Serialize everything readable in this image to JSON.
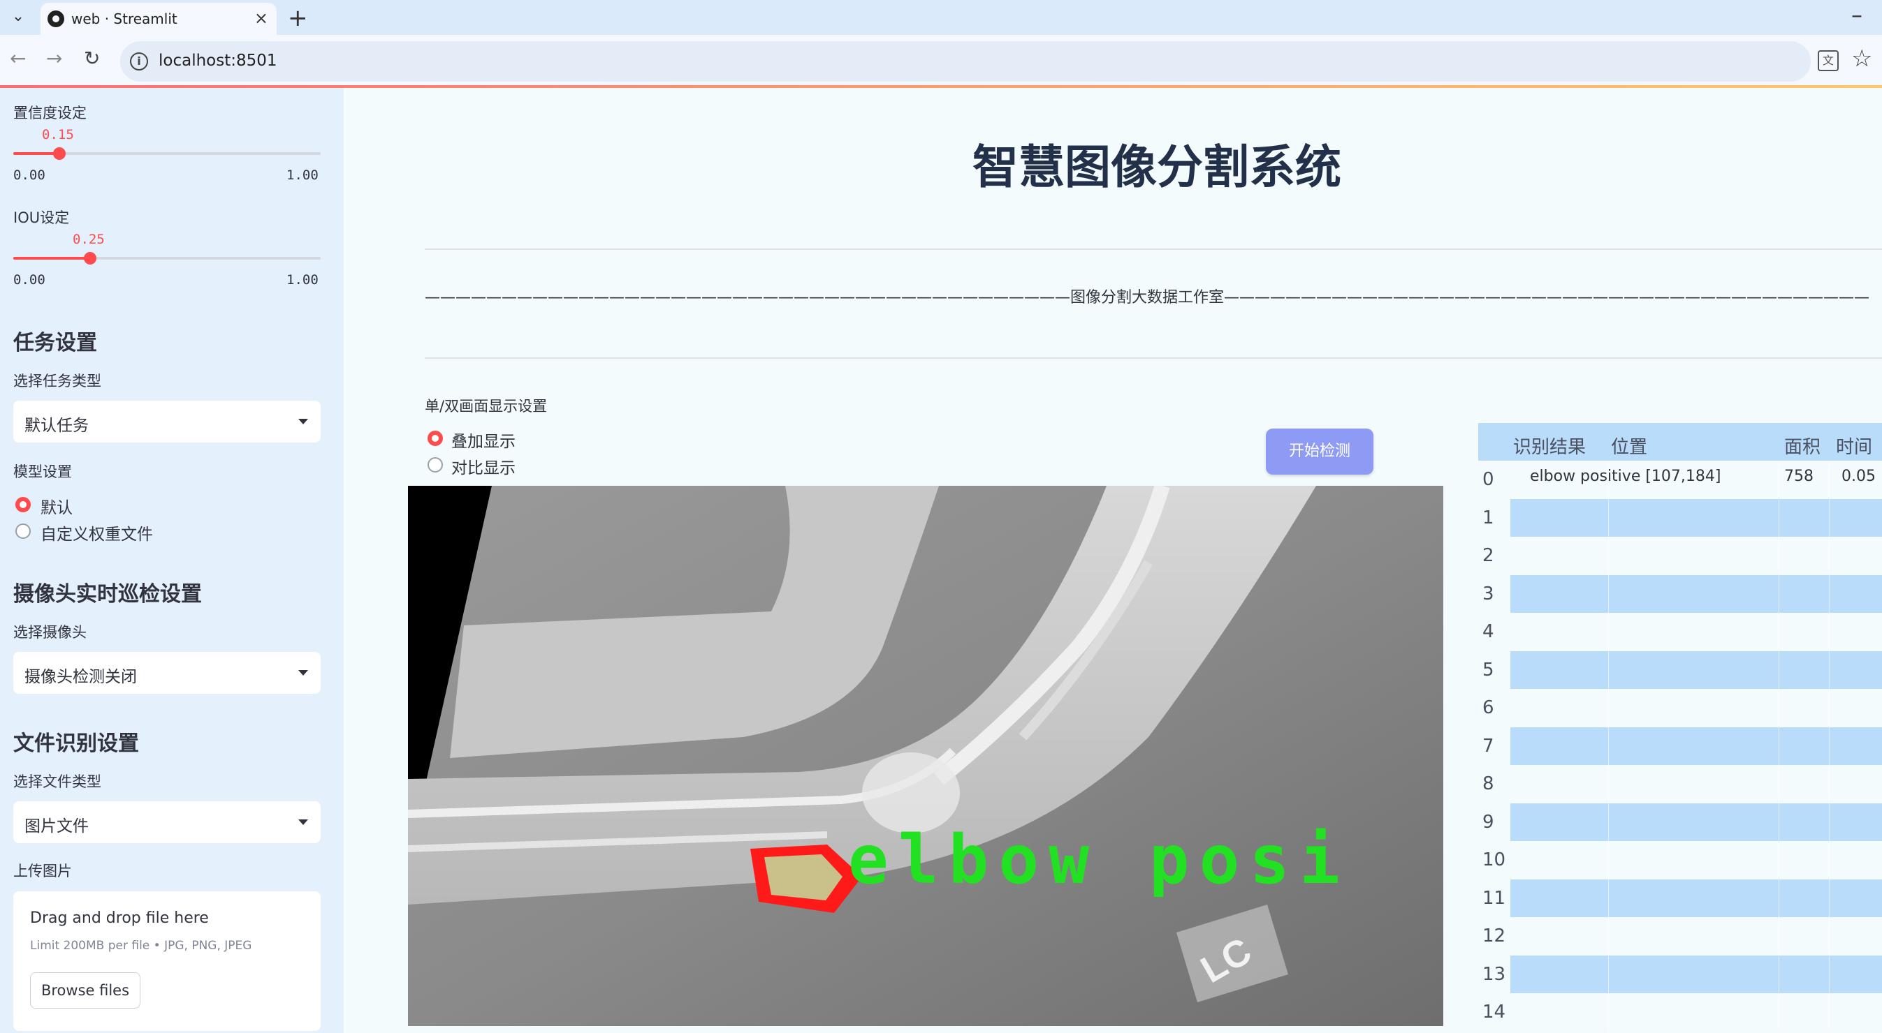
{
  "browser": {
    "tab_title": "web · Streamlit",
    "url": "localhost:8501"
  },
  "sidebar": {
    "confidence": {
      "label": "置信度设定",
      "value": "0.15",
      "value_fraction": 0.15,
      "min": "0.00",
      "max": "1.00"
    },
    "iou": {
      "label": "IOU设定",
      "value": "0.25",
      "value_fraction": 0.25,
      "min": "0.00",
      "max": "1.00"
    },
    "task_section": {
      "title": "任务设置",
      "select_label": "选择任务类型",
      "select_value": "默认任务"
    },
    "model_section": {
      "label": "模型设置",
      "options": [
        "默认",
        "自定义权重文件"
      ],
      "selected": 0
    },
    "camera_section": {
      "title": "摄像头实时巡检设置",
      "select_label": "选择摄像头",
      "select_value": "摄像头检测关闭"
    },
    "file_section": {
      "title": "文件识别设置",
      "select_label": "选择文件类型",
      "select_value": "图片文件"
    },
    "upload": {
      "label": "上传图片",
      "drop_text": "Drag and drop file here",
      "limit_text": "Limit 200MB per file • JPG, PNG, JPEG",
      "browse_label": "Browse files"
    }
  },
  "main": {
    "title": "智慧图像分割系统",
    "studio_line": "——————————————————————————————————————————图像分割大数据工作室——————————————————————————————————————————",
    "display_label": "单/双画面显示设置",
    "display_options": [
      "叠加显示",
      "对比显示"
    ],
    "display_selected": 0,
    "start_button": "开始检测",
    "overlay_label": "elbow posi",
    "overlay_caption": "LC"
  },
  "table": {
    "headers": [
      "识别结果",
      "位置",
      "面积",
      "时间"
    ],
    "row_indices": [
      "0",
      "1",
      "2",
      "3",
      "4",
      "5",
      "6",
      "7",
      "8",
      "9",
      "10",
      "11",
      "12",
      "13",
      "14"
    ],
    "rows": [
      {
        "result": "elbow positive",
        "position": "[107,184]",
        "area": "758",
        "time": "0.05"
      }
    ]
  },
  "colors": {
    "accent": "#ff4b4b",
    "sidebar_bg": "#e4f0fb",
    "main_bg": "#f4fbfd",
    "table_header": "#b9dcfb",
    "button_bg": "#8d9bf5",
    "overlay_green": "#22e022",
    "mask_red": "#ff1a1a"
  }
}
